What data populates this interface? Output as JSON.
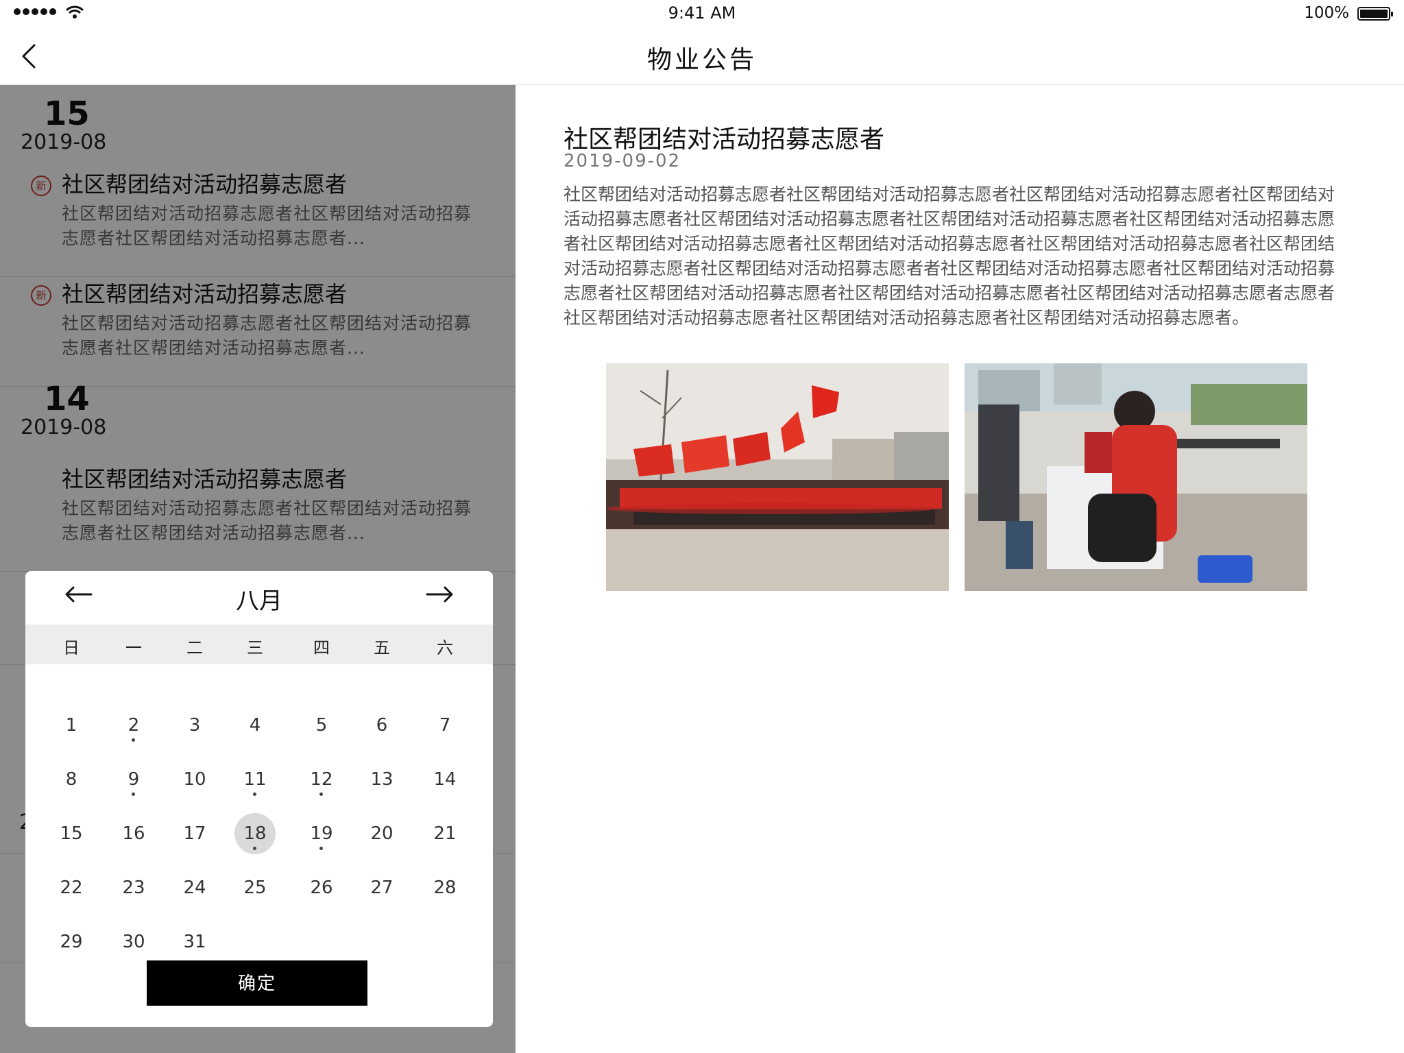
{
  "status_bar": {
    "time": "9:41 AM",
    "battery": "100%"
  },
  "nav": {
    "title": "物业公告",
    "back_icon": "chevron-left-icon"
  },
  "list": {
    "badge_new": "新",
    "groups": [
      {
        "day": "15",
        "month": "2019-08",
        "items": [
          {
            "title": "社区帮团结对活动招募志愿者",
            "summary_line1": "社区帮团结对活动招募志愿者社区帮团结对活动招募",
            "summary_line2": "志愿者社区帮团结对活动招募志愿者..."
          },
          {
            "title": "社区帮团结对活动招募志愿者",
            "summary_line1": "社区帮团结对活动招募志愿者社区帮团结对活动招募",
            "summary_line2": "志愿者社区帮团结对活动招募志愿者..."
          }
        ]
      },
      {
        "day": "14",
        "month": "2019-08",
        "items": [
          {
            "title": "社区帮团结对活动招募志愿者",
            "summary_line1": "社区帮团结对活动招募志愿者社区帮团结对活动招募",
            "summary_line2": "志愿者社区帮团结对活动招募志愿者..."
          }
        ]
      }
    ],
    "partial_char": "2"
  },
  "calendar": {
    "month": "八月",
    "prev_icon": "arrow-left-icon",
    "next_icon": "arrow-right-icon",
    "weekdays": [
      "日",
      "一",
      "二",
      "三",
      "四",
      "五",
      "六"
    ],
    "days": [
      "1",
      "2",
      "3",
      "4",
      "5",
      "6",
      "7",
      "8",
      "9",
      "10",
      "11",
      "12",
      "13",
      "14",
      "15",
      "16",
      "17",
      "18",
      "19",
      "20",
      "21",
      "22",
      "23",
      "24",
      "25",
      "26",
      "27",
      "28",
      "29",
      "30",
      "31"
    ],
    "marked_days": [
      "2",
      "9",
      "11",
      "12",
      "18",
      "19"
    ],
    "selected_day": "18",
    "confirm_label": "确定"
  },
  "detail": {
    "title": "社区帮团结对活动招募志愿者",
    "date": "2019-09-02",
    "body_lines": [
      "社区帮团结对活动招募志愿者社区帮团结对活动招募志愿者社区帮团结对活动招募志愿者社区帮团结对",
      "活动招募志愿者社区帮团结对活动招募志愿者社区帮团结对活动招募志愿者社区帮团结对活动招募志愿",
      "者社区帮团结对活动招募志愿者社区帮团结对活动招募志愿者社区帮团结对活动招募志愿者社区帮团结",
      "对活动招募志愿者社区帮团结对活动招募志愿者者社区帮团结对活动招募志愿者社区帮团结对活动招募",
      "志愿者社区帮团结对活动招募志愿者社区帮团结对活动招募志愿者社区帮团结对活动招募志愿者志愿者",
      "社区帮团结对活动招募志愿者社区帮团结对活动招募志愿者社区帮团结对活动招募志愿者。"
    ]
  }
}
